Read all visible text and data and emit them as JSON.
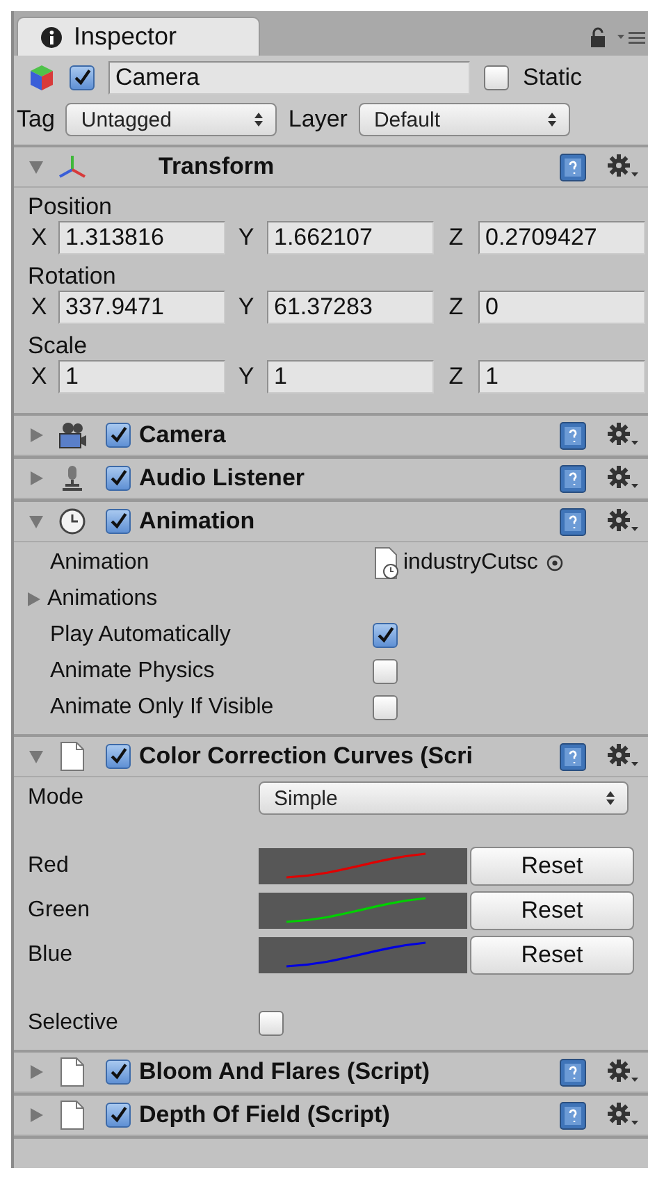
{
  "tab": {
    "title": "Inspector"
  },
  "object": {
    "active": true,
    "name": "Camera",
    "static": false,
    "static_label": "Static"
  },
  "tag": {
    "label": "Tag",
    "value": "Untagged"
  },
  "layer": {
    "label": "Layer",
    "value": "Default"
  },
  "components": [
    {
      "kind": "transform",
      "title": "Transform",
      "expanded": true,
      "vectors": [
        {
          "label": "Position",
          "axes": [
            {
              "axis": "X",
              "value": "1.313816"
            },
            {
              "axis": "Y",
              "value": "1.662107"
            },
            {
              "axis": "Z",
              "value": "0.2709427"
            }
          ]
        },
        {
          "label": "Rotation",
          "axes": [
            {
              "axis": "X",
              "value": "337.9471"
            },
            {
              "axis": "Y",
              "value": "61.37283"
            },
            {
              "axis": "Z",
              "value": "0"
            }
          ]
        },
        {
          "label": "Scale",
          "axes": [
            {
              "axis": "X",
              "value": "1"
            },
            {
              "axis": "Y",
              "value": "1"
            },
            {
              "axis": "Z",
              "value": "1"
            }
          ]
        }
      ]
    },
    {
      "kind": "camera",
      "title": "Camera",
      "expanded": false,
      "enabled": true
    },
    {
      "kind": "audio",
      "title": "Audio Listener",
      "expanded": false,
      "enabled": true
    },
    {
      "kind": "animation",
      "title": "Animation",
      "expanded": true,
      "enabled": true,
      "properties": [
        {
          "kind": "object",
          "label": "Animation",
          "value": "industryCutsc"
        },
        {
          "kind": "foldout",
          "label": "Animations",
          "expanded": false
        },
        {
          "kind": "checkbox",
          "label": "Play Automatically",
          "checked": true
        },
        {
          "kind": "checkbox",
          "label": "Animate Physics",
          "checked": false
        },
        {
          "kind": "checkbox",
          "label": "Animate Only If Visible",
          "checked": false
        }
      ]
    },
    {
      "kind": "script",
      "title": "Color Correction Curves (Scri",
      "expanded": true,
      "enabled": true,
      "properties": [
        {
          "kind": "dropdown",
          "label": "Mode",
          "value": "Simple"
        },
        {
          "kind": "spacer"
        },
        {
          "kind": "curve",
          "label": "Red",
          "color": "#e00000",
          "button": "Reset"
        },
        {
          "kind": "curve",
          "label": "Green",
          "color": "#00d000",
          "button": "Reset"
        },
        {
          "kind": "curve",
          "label": "Blue",
          "color": "#0000e0",
          "button": "Reset"
        },
        {
          "kind": "spacer"
        },
        {
          "kind": "checkbox",
          "label": "Selective",
          "checked": false
        }
      ]
    },
    {
      "kind": "script",
      "title": "Bloom And Flares (Script)",
      "expanded": false,
      "enabled": true
    },
    {
      "kind": "script",
      "title": "Depth Of Field (Script)",
      "expanded": false,
      "enabled": true
    }
  ]
}
